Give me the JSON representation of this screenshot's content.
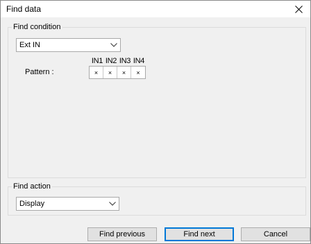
{
  "window": {
    "title": "Find data",
    "close_icon": "close-icon"
  },
  "find_condition": {
    "legend": "Find condition",
    "type_select": {
      "value": "Ext IN"
    },
    "pattern_label": "Pattern :",
    "columns": [
      "IN1",
      "IN2",
      "IN3",
      "IN4"
    ],
    "cells": [
      "×",
      "×",
      "×",
      "×"
    ]
  },
  "find_action": {
    "legend": "Find action",
    "action_select": {
      "value": "Display"
    }
  },
  "buttons": {
    "find_previous": "Find previous",
    "find_next": "Find next",
    "cancel": "Cancel"
  },
  "colors": {
    "dialog_bg": "#f0f0f0",
    "default_button_border": "#0078d7"
  }
}
